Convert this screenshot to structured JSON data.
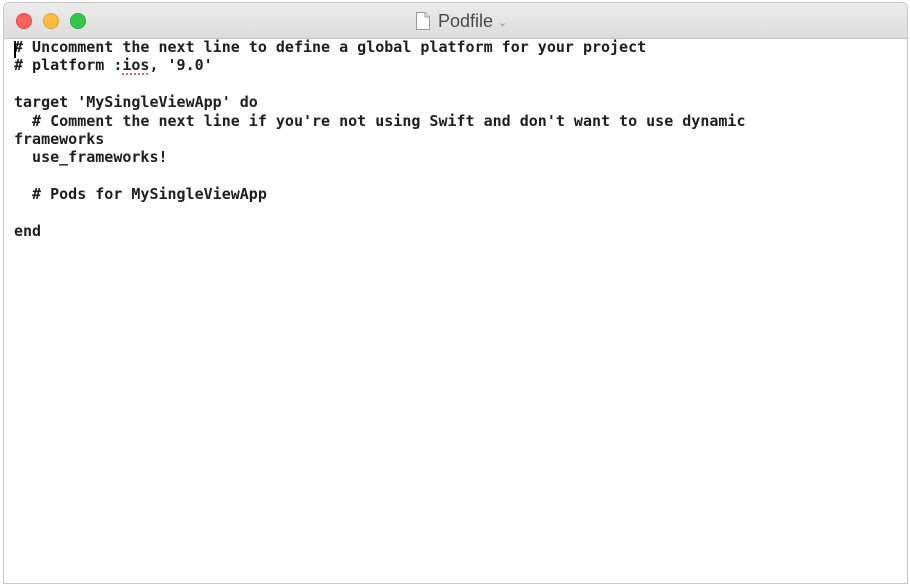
{
  "window": {
    "title": "Podfile",
    "chevron": "⌄"
  },
  "editor": {
    "lines": [
      "# Uncomment the next line to define a global platform for your project",
      "# platform :ios, '9.0'",
      "",
      "target 'MySingleViewApp' do",
      "  # Comment the next line if you're not using Swift and don't want to use dynamic",
      "frameworks",
      "  use_frameworks!",
      "",
      "  # Pods for MySingleViewApp",
      "",
      "end"
    ],
    "line2_parts": {
      "before": "# platform :",
      "misspelled": "ios",
      "after": ", '9.0'"
    }
  },
  "colors": {
    "close": "#fc605c",
    "minimize": "#fdbc40",
    "zoom": "#34c84a",
    "spellcheck": "#e03030"
  }
}
